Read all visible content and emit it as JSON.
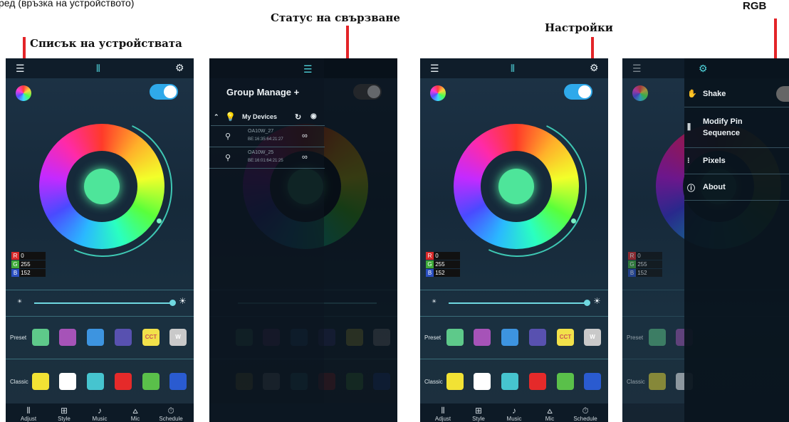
{
  "annotations": {
    "top_left_partial": "ред (връзка на устройството)",
    "device_list": "Списък на устройствата",
    "connection_status": "Статус на свързване",
    "settings": "Настройки",
    "rgb": "RGB"
  },
  "rgb_values": {
    "r_label": "R",
    "r": "0",
    "g_label": "G",
    "g": "255",
    "b_label": "B",
    "b": "152"
  },
  "row_labels": {
    "preset": "Preset",
    "classic": "Classic"
  },
  "preset_swatches": [
    {
      "color": "#5ec98a",
      "text": ""
    },
    {
      "color": "#a653b8",
      "text": ""
    },
    {
      "color": "#3d94e0",
      "text": ""
    },
    {
      "color": "#5851b0",
      "text": ""
    },
    {
      "color": "#f2e14a",
      "text": "CCT"
    },
    {
      "color": "#c9c9c9",
      "text": "W"
    }
  ],
  "classic_swatches": [
    {
      "color": "#f2e234"
    },
    {
      "color": "#ffffff"
    },
    {
      "color": "#46c4cf"
    },
    {
      "color": "#e52a2a"
    },
    {
      "color": "#5ac04a"
    },
    {
      "color": "#2a5bd0"
    }
  ],
  "tabs": [
    {
      "label": "Adjust",
      "glyph": "⫴",
      "icon": "sliders-icon"
    },
    {
      "label": "Style",
      "glyph": "⊞",
      "icon": "grid-icon"
    },
    {
      "label": "Music",
      "glyph": "♪",
      "icon": "music-icon"
    },
    {
      "label": "Mic",
      "glyph": "🎙",
      "icon": "mic-icon"
    },
    {
      "label": "Schedule",
      "glyph": "⏱",
      "icon": "clock-icon"
    }
  ],
  "group_panel": {
    "title": "Group Manage",
    "add": "+",
    "my_devices": "My Devices",
    "devices": [
      {
        "name": "OA10W_27",
        "mac": "BE:16:35:64:21:27"
      },
      {
        "name": "OA10W_25",
        "mac": "BE:16:01:64:21:25"
      }
    ]
  },
  "settings_menu": [
    {
      "label": "Shake",
      "icon": "shake-icon",
      "glyph": "✋"
    },
    {
      "label": "Modify Pin Sequence",
      "icon": "pin-sequence-icon",
      "glyph": "⫼"
    },
    {
      "label": "Pixels",
      "icon": "pixels-icon",
      "glyph": "⁝"
    },
    {
      "label": "About",
      "icon": "info-icon",
      "glyph": "ⓘ"
    }
  ],
  "colors": {
    "accent": "#2fa9ea",
    "annotation_line": "#e32428"
  }
}
